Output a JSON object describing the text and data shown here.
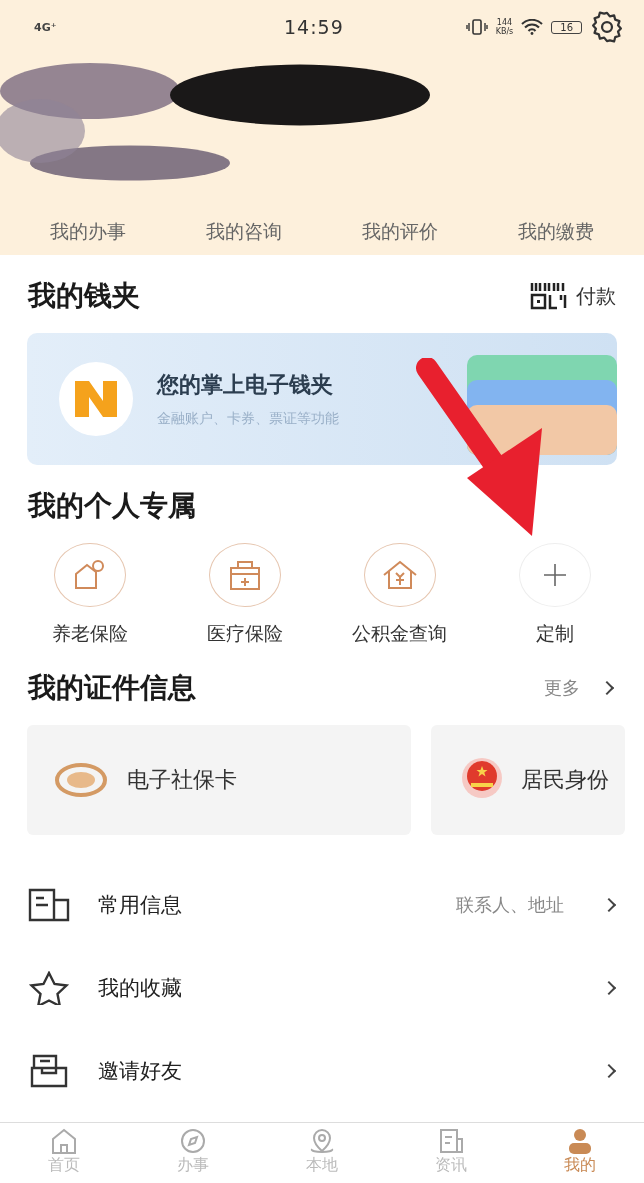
{
  "status_bar": {
    "network": "4G⁺",
    "time": "14:59",
    "speed": "144",
    "speed_unit": "KB/s",
    "battery": "16"
  },
  "header_links": [
    {
      "label": "我的办事"
    },
    {
      "label": "我的咨询"
    },
    {
      "label": "我的评价"
    },
    {
      "label": "我的缴费"
    }
  ],
  "wallet": {
    "title": "我的钱夹",
    "pay_label": "付款",
    "banner_title": "您的掌上电子钱夹",
    "banner_subtitle": "金融账户、卡券、票证等功能"
  },
  "personal": {
    "title": "我的个人专属",
    "items": [
      {
        "kind": "pension",
        "label": "养老保险"
      },
      {
        "kind": "medical",
        "label": "医疗保险"
      },
      {
        "kind": "fund",
        "label": "公积金查询"
      },
      {
        "kind": "add",
        "label": "定制"
      }
    ]
  },
  "certificates": {
    "title": "我的证件信息",
    "more": "更多",
    "cards": [
      {
        "kind": "social",
        "label": "电子社保卡"
      },
      {
        "kind": "id",
        "label": "居民身份"
      }
    ]
  },
  "menu": [
    {
      "kind": "info",
      "label": "常用信息",
      "hint": "联系人、地址"
    },
    {
      "kind": "star",
      "label": "我的收藏"
    },
    {
      "kind": "invite",
      "label": "邀请好友"
    }
  ],
  "tabs": [
    {
      "kind": "home",
      "label": "首页",
      "selected": false
    },
    {
      "kind": "compass",
      "label": "办事",
      "selected": false
    },
    {
      "kind": "pin",
      "label": "本地",
      "selected": false
    },
    {
      "kind": "news",
      "label": "资讯",
      "selected": false
    },
    {
      "kind": "person",
      "label": "我的",
      "selected": true
    }
  ]
}
